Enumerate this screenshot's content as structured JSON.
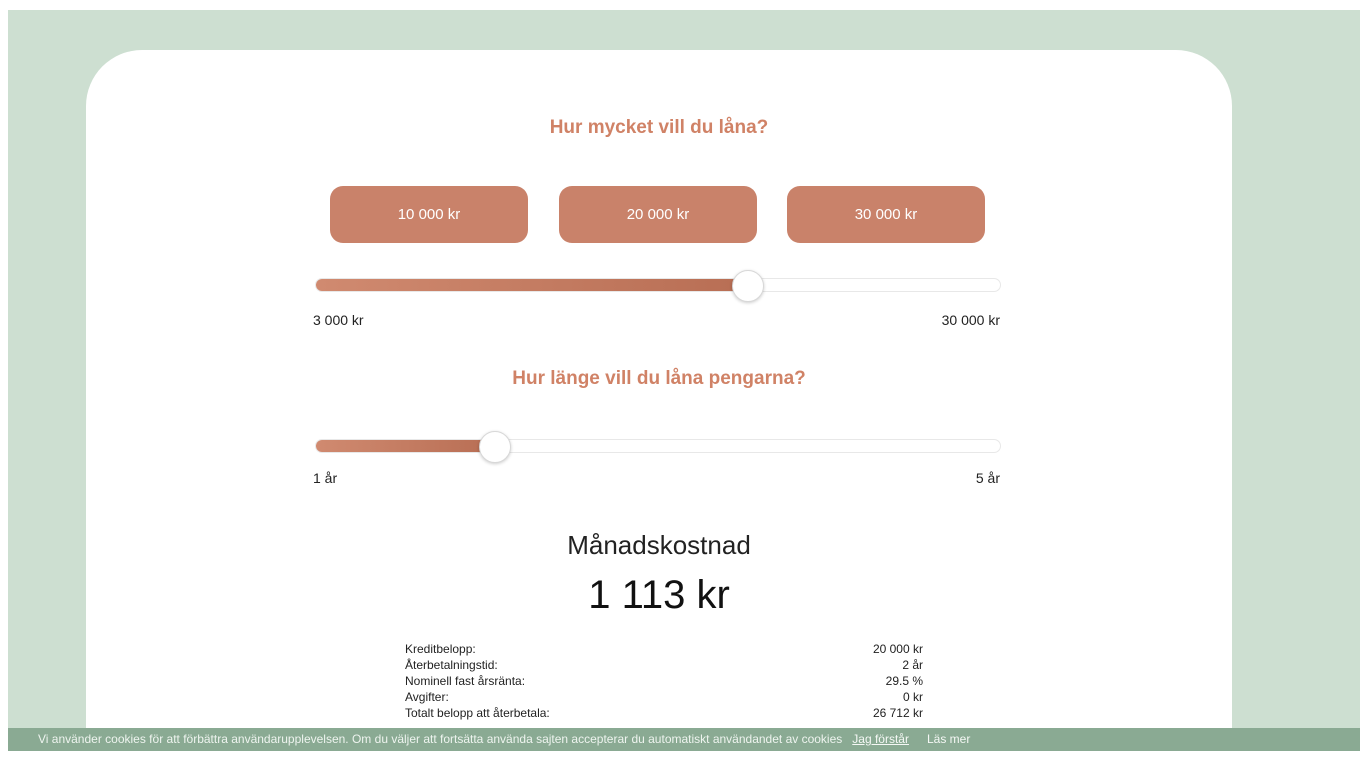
{
  "amount": {
    "heading": "Hur mycket vill du låna?",
    "presets": [
      "10 000 kr",
      "20 000 kr",
      "30 000 kr"
    ],
    "min_label": "3 000 kr",
    "max_label": "30 000 kr",
    "value_fraction": 0.63
  },
  "duration": {
    "heading": "Hur länge vill du låna pengarna?",
    "min_label": "1 år",
    "max_label": "5 år",
    "value_fraction": 0.26
  },
  "result": {
    "title": "Månadskostnad",
    "value": "1 113 kr"
  },
  "details": [
    {
      "label": "Kreditbelopp:",
      "value": "20 000 kr"
    },
    {
      "label": "Återbetalningstid:",
      "value": "2 år"
    },
    {
      "label": "Nominell fast årsränta:",
      "value": "29.5 %"
    },
    {
      "label": "Avgifter:",
      "value": "0 kr"
    },
    {
      "label": "Totalt belopp att återbetala:",
      "value": "26 712 kr"
    }
  ],
  "cookie": {
    "text": "Vi använder cookies för att förbättra användarupplevelsen. Om du väljer att fortsätta använda sajten accepterar du automatiskt användandet av cookies",
    "accept": "Jag förstår",
    "more": "Läs mer"
  },
  "colors": {
    "background": "#cddfd1",
    "accent": "#c9826a",
    "heading": "#d08266",
    "cookie_bar": "#8aaa93"
  }
}
